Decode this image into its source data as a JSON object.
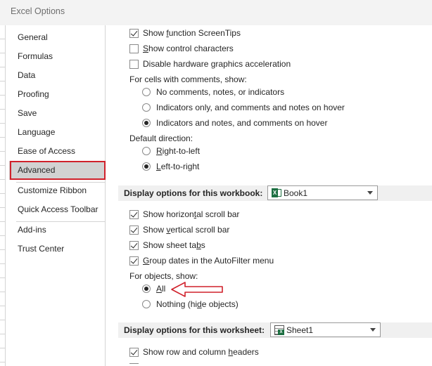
{
  "window": {
    "title": "Excel Options"
  },
  "sidebar": {
    "items": [
      {
        "label": "General"
      },
      {
        "label": "Formulas"
      },
      {
        "label": "Data"
      },
      {
        "label": "Proofing"
      },
      {
        "label": "Save"
      },
      {
        "label": "Language"
      },
      {
        "label": "Ease of Access"
      },
      {
        "label": "Advanced"
      },
      {
        "label": "Customize Ribbon"
      },
      {
        "label": "Quick Access Toolbar"
      },
      {
        "label": "Add-ins"
      },
      {
        "label": "Trust Center"
      }
    ],
    "active": "Advanced",
    "highlight_color": "#d0212b"
  },
  "display": {
    "show_function_screentips": {
      "pre": "Show ",
      "u": "f",
      "post": "unction ScreenTips",
      "checked": true
    },
    "show_control_characters": {
      "pre": "",
      "u": "S",
      "post": "how control characters",
      "checked": false
    },
    "disable_hw_accel": {
      "pre": "Disable hardware ",
      "u": "g",
      "post": "raphics acceleration",
      "checked": false
    },
    "comments_heading": "For cells with comments, show:",
    "comments_options": [
      {
        "label": "No comments, notes, or indicators",
        "checked": false
      },
      {
        "label": "Indicators only, and comments and notes on hover",
        "checked": false
      },
      {
        "label": "Indicators and notes, and comments on hover",
        "checked": true
      }
    ],
    "direction_heading": "Default direction:",
    "direction_options": [
      {
        "pre": "",
        "u": "R",
        "post": "ight-to-left",
        "checked": false
      },
      {
        "pre": "",
        "u": "L",
        "post": "eft-to-right",
        "checked": true
      }
    ]
  },
  "workbook_section": {
    "header": "Display options for this workbook:",
    "header_underline": "b",
    "selected": "Book1",
    "options": [
      {
        "pre": "Show horizon",
        "u": "t",
        "post": "al scroll bar",
        "checked": true
      },
      {
        "pre": "Show ",
        "u": "v",
        "post": "ertical scroll bar",
        "checked": true
      },
      {
        "pre": "Show sheet ta",
        "u": "b",
        "post": "s",
        "checked": true
      },
      {
        "pre": "",
        "u": "G",
        "post": "roup dates in the AutoFilter menu",
        "checked": true
      }
    ],
    "objects_heading": "For objects, show:",
    "objects_options": [
      {
        "pre": "",
        "u": "A",
        "post": "ll",
        "checked": true
      },
      {
        "pre": "Nothing (hi",
        "u": "d",
        "post": "e objects)",
        "checked": false
      }
    ],
    "arrow_color": "#d0212b"
  },
  "worksheet_section": {
    "header": "Display options for this worksheet:",
    "selected": "Sheet1",
    "options": [
      {
        "pre": "Show row and column ",
        "u": "h",
        "post": "eaders",
        "checked": true
      }
    ]
  }
}
